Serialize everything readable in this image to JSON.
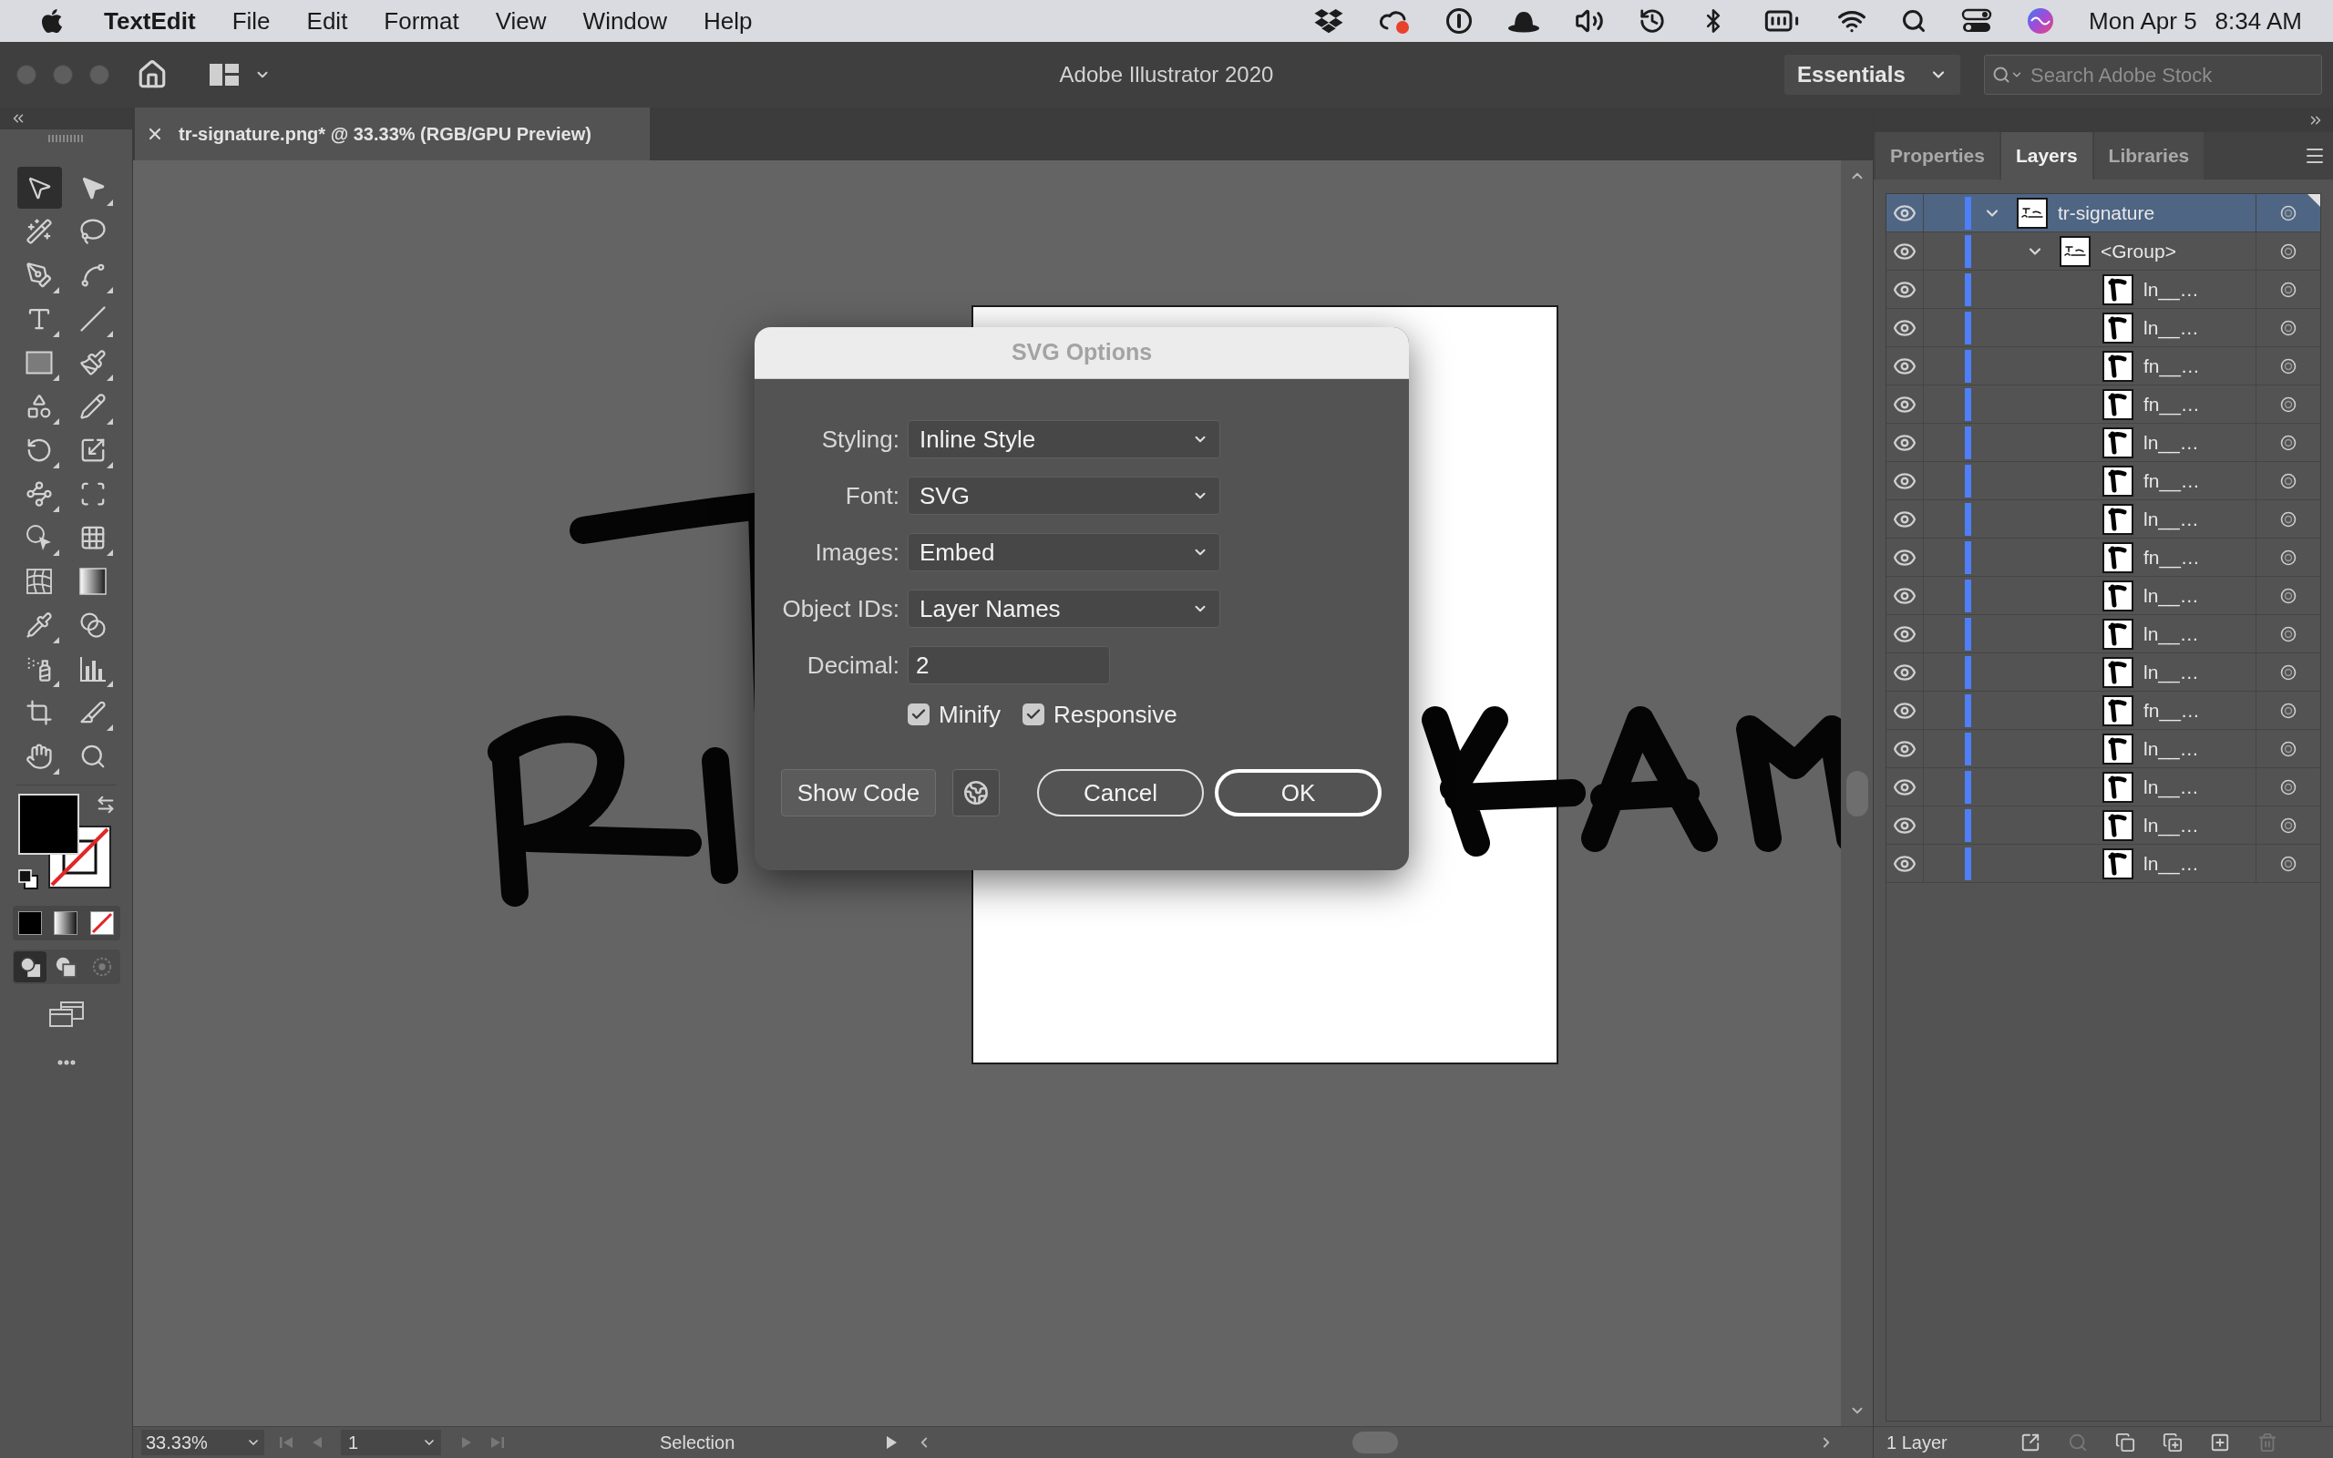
{
  "menu_bar": {
    "app_name": "TextEdit",
    "menus": [
      "File",
      "Edit",
      "Format",
      "View",
      "Window",
      "Help"
    ],
    "date": "Mon Apr 5",
    "time": "8:34 AM"
  },
  "title_bar": {
    "title": "Adobe Illustrator 2020",
    "workspace": "Essentials",
    "search": {
      "placeholder": "Search Adobe Stock"
    }
  },
  "document_tab": {
    "title": "tr-signature.png* @ 33.33% (RGB/GPU Preview)"
  },
  "toolbar": {
    "tools": [
      {
        "selected": true,
        "flyout": false
      },
      {
        "selected": false,
        "flyout": true
      },
      {
        "selected": false,
        "flyout": false
      },
      {
        "selected": false,
        "flyout": false
      },
      {
        "selected": false,
        "flyout": true
      },
      {
        "selected": false,
        "flyout": true
      },
      {
        "selected": false,
        "flyout": true
      },
      {
        "selected": false,
        "flyout": true
      },
      {
        "selected": false,
        "flyout": true
      },
      {
        "selected": false,
        "flyout": true
      },
      {
        "selected": false,
        "flyout": true
      },
      {
        "selected": false,
        "flyout": true
      },
      {
        "selected": false,
        "flyout": true
      },
      {
        "selected": false,
        "flyout": true
      },
      {
        "selected": false,
        "flyout": true
      },
      {
        "selected": false,
        "flyout": false
      },
      {
        "selected": false,
        "flyout": true
      },
      {
        "selected": false,
        "flyout": true
      },
      {
        "selected": false,
        "flyout": false
      },
      {
        "selected": false,
        "flyout": false
      },
      {
        "selected": false,
        "flyout": true
      },
      {
        "selected": false,
        "flyout": false
      },
      {
        "selected": false,
        "flyout": true
      },
      {
        "selected": false,
        "flyout": true
      },
      {
        "selected": false,
        "flyout": false
      },
      {
        "selected": false,
        "flyout": true
      },
      {
        "selected": false,
        "flyout": true
      },
      {
        "selected": false,
        "flyout": false
      }
    ],
    "draw_modes": [
      {
        "selected": true
      },
      {
        "selected": false
      },
      {
        "selected": false
      }
    ]
  },
  "dialog": {
    "title": "SVG Options",
    "fields": [
      {
        "kind": "select",
        "label": "Styling:",
        "value": "Inline Style"
      },
      {
        "kind": "select",
        "label": "Font:",
        "value": "SVG"
      },
      {
        "kind": "select",
        "label": "Images:",
        "value": "Embed"
      },
      {
        "kind": "select",
        "label": "Object IDs:",
        "value": "Layer Names"
      },
      {
        "kind": "text",
        "label": "Decimal:",
        "value": "2"
      }
    ],
    "checkboxes": [
      {
        "label": "Minify",
        "checked": true
      },
      {
        "label": "Responsive",
        "checked": true
      }
    ],
    "show_code_button": "Show Code",
    "buttons": [
      {
        "label": "Cancel",
        "default": false
      },
      {
        "label": "OK",
        "default": true
      }
    ]
  },
  "status_bar": {
    "zoom": "33.33%",
    "artboard_nav": [
      {
        "disabled": true
      },
      {
        "disabled": true
      },
      {
        "disabled": true
      },
      {
        "disabled": true
      }
    ],
    "artboard": "1",
    "tool": "Selection"
  },
  "panel": {
    "tabs": [
      {
        "label": "Properties",
        "selected": false
      },
      {
        "label": "Layers",
        "selected": true
      },
      {
        "label": "Libraries",
        "selected": false
      }
    ],
    "layers": [
      {
        "name": "tr-signature",
        "visible": true,
        "selected": true,
        "expanded": true,
        "children": [
          {
            "name": "<Group>",
            "visible": true,
            "selected": false,
            "expanded": true,
            "children": [
              {
                "name": "ln__…",
                "visible": true,
                "selected": false
              },
              {
                "name": "ln__…",
                "visible": true,
                "selected": false
              },
              {
                "name": "fn__…",
                "visible": true,
                "selected": false
              },
              {
                "name": "fn__…",
                "visible": true,
                "selected": false
              },
              {
                "name": "ln__…",
                "visible": true,
                "selected": false
              },
              {
                "name": "fn__…",
                "visible": true,
                "selected": false
              },
              {
                "name": "ln__…",
                "visible": true,
                "selected": false
              },
              {
                "name": "fn__…",
                "visible": true,
                "selected": false
              },
              {
                "name": "ln__…",
                "visible": true,
                "selected": false
              },
              {
                "name": "ln__…",
                "visible": true,
                "selected": false
              },
              {
                "name": "ln__…",
                "visible": true,
                "selected": false
              },
              {
                "name": "fn__…",
                "visible": true,
                "selected": false
              },
              {
                "name": "ln__…",
                "visible": true,
                "selected": false
              },
              {
                "name": "ln__…",
                "visible": true,
                "selected": false
              },
              {
                "name": "ln__…",
                "visible": true,
                "selected": false
              },
              {
                "name": "ln__…",
                "visible": true,
                "selected": false
              }
            ]
          }
        ]
      }
    ],
    "footer": {
      "count": "1 Layer",
      "buttons": [
        {
          "disabled": false
        },
        {
          "disabled": true
        },
        {
          "disabled": false
        },
        {
          "disabled": false
        },
        {
          "disabled": false
        },
        {
          "disabled": true
        }
      ]
    }
  }
}
